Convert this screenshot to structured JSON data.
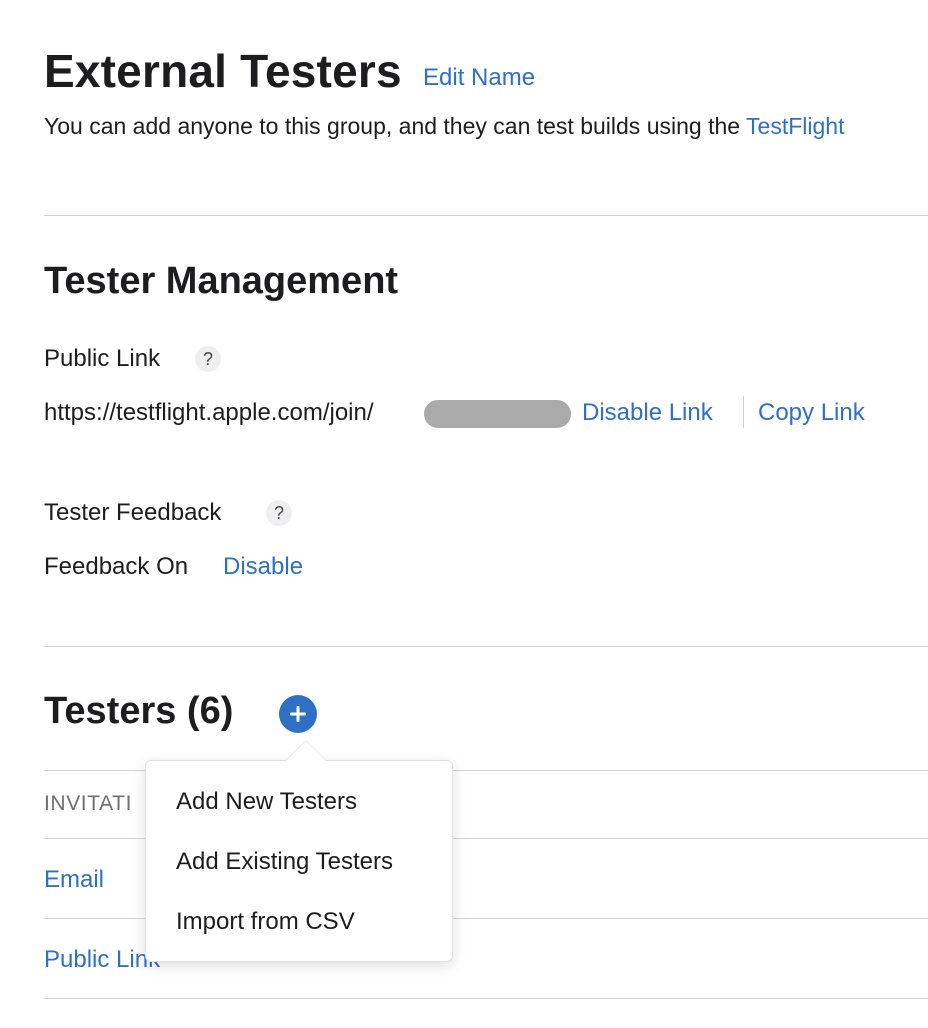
{
  "header": {
    "title": "External Testers",
    "edit_name_label": "Edit Name",
    "description": "You can add anyone to this group, and they can test builds using the ",
    "description_link": "TestFlight"
  },
  "tester_management": {
    "heading": "Tester Management",
    "public_link": {
      "label": "Public Link",
      "help": "?",
      "url_prefix": "https://testflight.apple.com/join/",
      "disable_label": "Disable Link",
      "copy_label": "Copy Link"
    },
    "feedback": {
      "label": "Tester Feedback",
      "help": "?",
      "status": "Feedback On",
      "disable_label": "Disable"
    }
  },
  "testers": {
    "heading": "Testers (6)",
    "add_icon": "plus-icon",
    "column_header": "INVITATI",
    "rows": [
      {
        "label": "Email"
      },
      {
        "label": "Public Link"
      }
    ]
  },
  "add_menu": {
    "items": [
      {
        "label": "Add New Testers"
      },
      {
        "label": "Add Existing Testers"
      },
      {
        "label": "Import from CSV"
      }
    ]
  },
  "colors": {
    "link": "#2f6fc6",
    "text": "#1d1d1f",
    "divider": "#d2d2d7",
    "redaction": "#aaaaaa"
  }
}
